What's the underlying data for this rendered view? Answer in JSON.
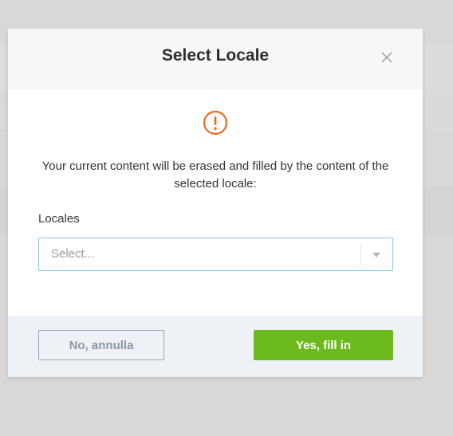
{
  "modal": {
    "title": "Select Locale",
    "close_icon": "close-icon",
    "warning_icon": "exclamation-circle-icon",
    "message": "Your current content will be erased and filled by the content of the selected locale:",
    "field": {
      "label": "Locales",
      "placeholder": "Select..."
    },
    "buttons": {
      "cancel_label": "No, annulla",
      "confirm_label": "Yes, fill in"
    }
  },
  "colors": {
    "warning": "#f06a1d",
    "confirm": "#6cba1e",
    "select_border": "#8cc4ea",
    "footer_bg": "#eef2f6"
  }
}
